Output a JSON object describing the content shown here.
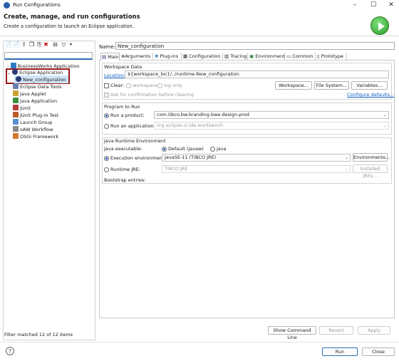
{
  "window": {
    "title": "Run Configurations"
  },
  "header": {
    "title": "Create, manage, and run configurations",
    "subtitle": "Create a configuration to launch an Eclipse application."
  },
  "left": {
    "filter_value": "",
    "tree": [
      {
        "label": "BusinessWorks Application",
        "icon": "bw-icon",
        "level": 0,
        "expander": ">"
      },
      {
        "label": "Eclipse Application",
        "icon": "eclipse-icon",
        "level": 0,
        "expander": "v"
      },
      {
        "label": "New_configuration",
        "icon": "eclipse-icon",
        "level": 1,
        "selected": true
      },
      {
        "label": "Eclipse Data Tools",
        "icon": "datatools-icon",
        "level": 0
      },
      {
        "label": "Java Applet",
        "icon": "applet-icon",
        "level": 0
      },
      {
        "label": "Java Application",
        "icon": "java-app-icon",
        "level": 0
      },
      {
        "label": "JUnit",
        "icon": "junit-icon",
        "level": 0
      },
      {
        "label": "JUnit Plug-in Test",
        "icon": "junit-plugin-icon",
        "level": 0
      },
      {
        "label": "Launch Group",
        "icon": "launch-group-icon",
        "level": 0
      },
      {
        "label": "oAW Workflow",
        "icon": "oaw-icon",
        "level": 0
      },
      {
        "label": "OSGi Framework",
        "icon": "osgi-icon",
        "level": 0
      }
    ],
    "status": "Filter matched 12 of 12 items"
  },
  "main": {
    "name_label": "Name:",
    "name_value": "New_configuration",
    "tabs": [
      "Main",
      "Arguments",
      "Plug-ins",
      "Configuration",
      "Tracing",
      "Environment",
      "Common",
      "Prototype"
    ],
    "workspace": {
      "title": "Workspace Data",
      "location_label": "Location:",
      "location_value": "${workspace_loc}/../runtime-New_configuration",
      "clear_label": "Clear:",
      "workspace_opt": "workspace",
      "log_only_opt": "log only",
      "buttons": [
        "Workspace...",
        "File System...",
        "Variables..."
      ],
      "ask_label": "Ask for confirmation before clearing",
      "configure_link": "Configure defaults..."
    },
    "program": {
      "title": "Program to Run",
      "run_product_label": "Run a product:",
      "product_value": "com.tibco.bw.branding.bwe.design.prod",
      "run_app_label": "Run an application:",
      "app_value": "org.eclipse.ui.ide.workbench"
    },
    "jre": {
      "title": "Java Runtime Environment",
      "java_exec_label": "Java executable:",
      "default_opt": "Default (javaw)",
      "java_opt": "java",
      "exec_env_label": "Execution environment:",
      "exec_env_value": "JavaSE-11 (TIBCO JRE)",
      "environments_btn": "Environments...",
      "runtime_jre_label": "Runtime JRE:",
      "runtime_jre_value": "TIBCO JRE",
      "installed_btn": "Installed JREs...",
      "bootstrap_label": "Bootstrap entries:"
    },
    "bottom_buttons": {
      "show_cmd": "Show Command Line",
      "revert": "Revert",
      "apply": "Apply"
    }
  },
  "footer": {
    "run": "Run",
    "close": "Close"
  },
  "colors": {
    "accent": "#2d6db5",
    "highlight_box": "#9a1a1a",
    "selection": "#cfe3f7",
    "link": "#0b58c0"
  }
}
